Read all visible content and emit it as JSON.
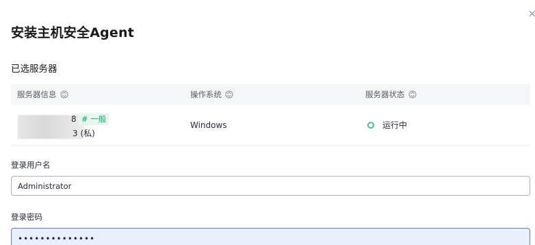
{
  "dialog": {
    "title": "安装主机安全Agent",
    "close_icon": "close-icon"
  },
  "selected": {
    "title": "已选服务器",
    "columns": [
      "服务器信息",
      "操作系统",
      "服务器状态"
    ],
    "rows": [
      {
        "name_suffix": "8",
        "tag": "# 一般",
        "ip_suffix": "3 (私)",
        "os": "Windows",
        "status": "运行中",
        "status_color": "#3ac295"
      }
    ]
  },
  "form": {
    "username_label": "登录用户名",
    "username_value": "Administrator",
    "password_label": "登录密码",
    "password_value": "••••••••••••••"
  }
}
